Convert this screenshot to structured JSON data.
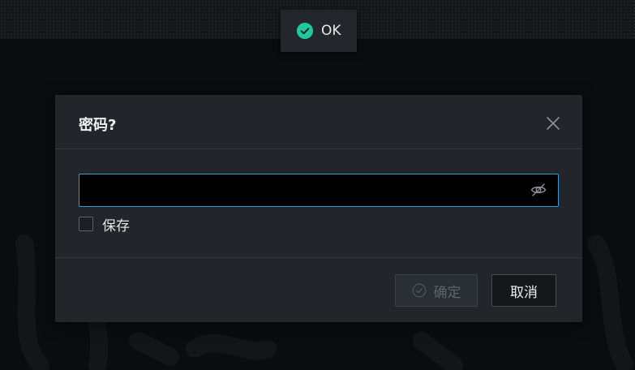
{
  "toast": {
    "icon": "check-circle-icon",
    "text": "OK",
    "accent": "#1fc9a0"
  },
  "dialog": {
    "title": "密码?",
    "close_icon": "close-icon",
    "password": {
      "value": "",
      "placeholder": "",
      "visibility_icon": "eye-off-icon",
      "focus_color": "#2f9ed6"
    },
    "save_checkbox": {
      "label": "保存",
      "checked": false
    },
    "confirm_button": {
      "label": "确定",
      "icon": "check-circle-icon",
      "disabled": true
    },
    "cancel_button": {
      "label": "取消"
    }
  }
}
